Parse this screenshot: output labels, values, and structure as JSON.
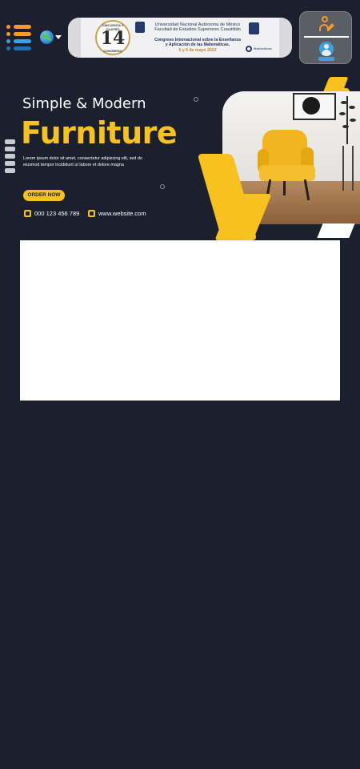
{
  "header": {
    "banner": {
      "seal_ring_top": "CINCUENTA Y CUATRO",
      "seal_number": "14",
      "seal_ring_bottom": "CONGRESO",
      "line1": "Universidad Nacional Autónoma de México",
      "line2": "Facultad de Estudios Superiores Cuautitlán",
      "line3": "Congreso Internacional sobre la Enseñanza",
      "line4": "y Aplicación de las Matemáticas.",
      "line5": "5 y 6 de mayo 2022",
      "mate_text": "Matemáticas"
    }
  },
  "hero": {
    "subtitle": "Simple & Modern",
    "title": "Furniture",
    "body": "Lorem ipsum dolor sit amet, consectetur adipiscing elit, sed do eiusmod tempor incididunt ut labore et dolore magna",
    "order_label": "ORDER NOW",
    "phone": "000 123 456 789",
    "website": "www.website.com",
    "accent_color": "#f7c21d"
  },
  "colors": {
    "background": "#1c1f2e",
    "accent": "#f7c21d",
    "user_panel": "#5c5e66"
  }
}
